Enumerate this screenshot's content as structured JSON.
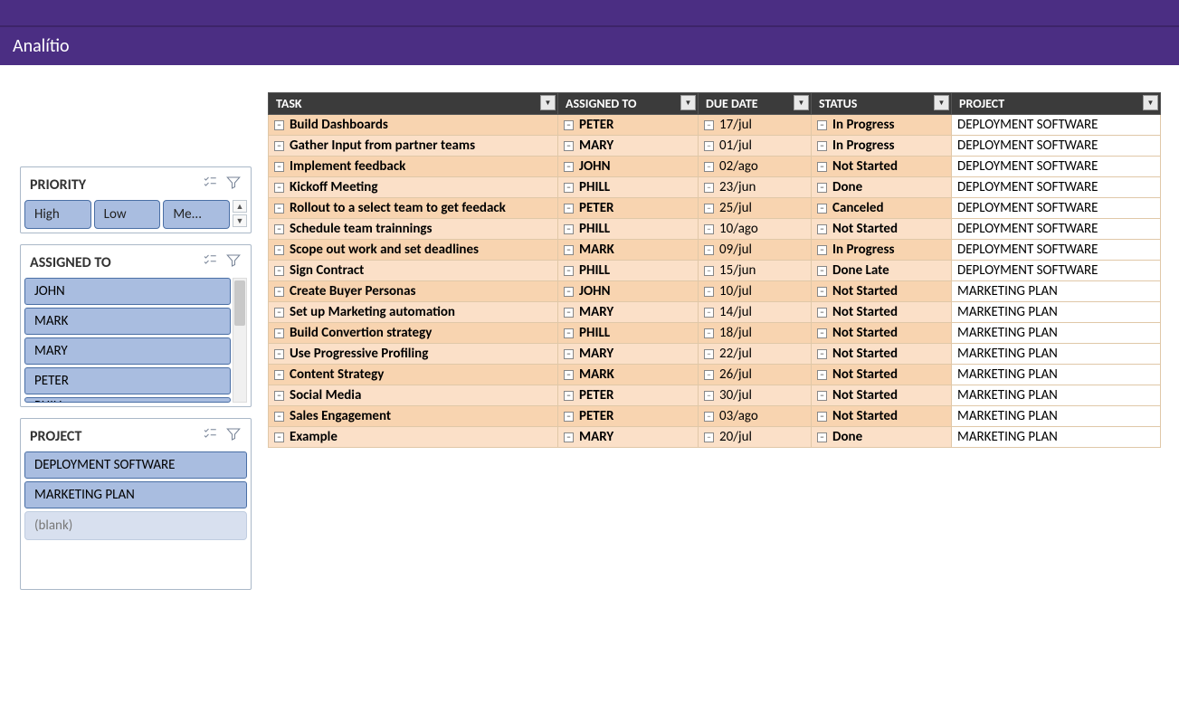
{
  "app": {
    "title": "Analítio"
  },
  "slicers": {
    "priority": {
      "title": "PRIORITY",
      "items": [
        "High",
        "Low",
        "Me..."
      ]
    },
    "assigned": {
      "title": "ASSIGNED TO",
      "items": [
        "JOHN",
        "MARK",
        "MARY",
        "PETER",
        "PHILL"
      ]
    },
    "project": {
      "title": "PROJECT",
      "items": [
        "DEPLOYMENT SOFTWARE",
        "MARKETING PLAN"
      ],
      "blank": "(blank)"
    }
  },
  "table": {
    "headers": {
      "task": "TASK",
      "assigned": "ASSIGNED TO",
      "due": "DUE DATE",
      "status": "STATUS",
      "project": "PROJECT"
    },
    "rows": [
      {
        "task": "Build Dashboards",
        "assigned": "PETER",
        "due": "17/jul",
        "status": "In Progress",
        "project": "DEPLOYMENT SOFTWARE"
      },
      {
        "task": "Gather Input from partner teams",
        "assigned": "MARY",
        "due": "01/jul",
        "status": "In Progress",
        "project": "DEPLOYMENT SOFTWARE"
      },
      {
        "task": "Implement feedback",
        "assigned": "JOHN",
        "due": "02/ago",
        "status": "Not Started",
        "project": "DEPLOYMENT SOFTWARE"
      },
      {
        "task": "Kickoff Meeting",
        "assigned": "PHILL",
        "due": "23/jun",
        "status": "Done",
        "project": "DEPLOYMENT SOFTWARE"
      },
      {
        "task": "Rollout to a select team to get feedack",
        "assigned": "PETER",
        "due": "25/jul",
        "status": "Canceled",
        "project": "DEPLOYMENT SOFTWARE"
      },
      {
        "task": "Schedule team trainnings",
        "assigned": "PHILL",
        "due": "10/ago",
        "status": "Not Started",
        "project": "DEPLOYMENT SOFTWARE"
      },
      {
        "task": "Scope out work and set deadlines",
        "assigned": "MARK",
        "due": "09/jul",
        "status": "In Progress",
        "project": "DEPLOYMENT SOFTWARE"
      },
      {
        "task": "Sign Contract",
        "assigned": "PHILL",
        "due": "15/jun",
        "status": "Done Late",
        "project": "DEPLOYMENT SOFTWARE"
      },
      {
        "task": "Create Buyer Personas",
        "assigned": "JOHN",
        "due": "10/jul",
        "status": "Not Started",
        "project": "MARKETING PLAN"
      },
      {
        "task": "Set up Marketing automation",
        "assigned": "MARY",
        "due": "14/jul",
        "status": "Not Started",
        "project": "MARKETING PLAN"
      },
      {
        "task": "Build Convertion strategy",
        "assigned": "PHILL",
        "due": "18/jul",
        "status": "Not Started",
        "project": "MARKETING PLAN"
      },
      {
        "task": "Use Progressive Profiling",
        "assigned": "MARY",
        "due": "22/jul",
        "status": "Not Started",
        "project": "MARKETING PLAN"
      },
      {
        "task": "Content Strategy",
        "assigned": "MARK",
        "due": "26/jul",
        "status": "Not Started",
        "project": "MARKETING PLAN"
      },
      {
        "task": "Social Media",
        "assigned": "PETER",
        "due": "30/jul",
        "status": "Not Started",
        "project": "MARKETING PLAN"
      },
      {
        "task": "Sales Engagement",
        "assigned": "PETER",
        "due": "03/ago",
        "status": "Not Started",
        "project": "MARKETING PLAN"
      },
      {
        "task": "Example",
        "assigned": "MARY",
        "due": "20/jul",
        "status": "Done",
        "project": "MARKETING PLAN"
      }
    ]
  }
}
